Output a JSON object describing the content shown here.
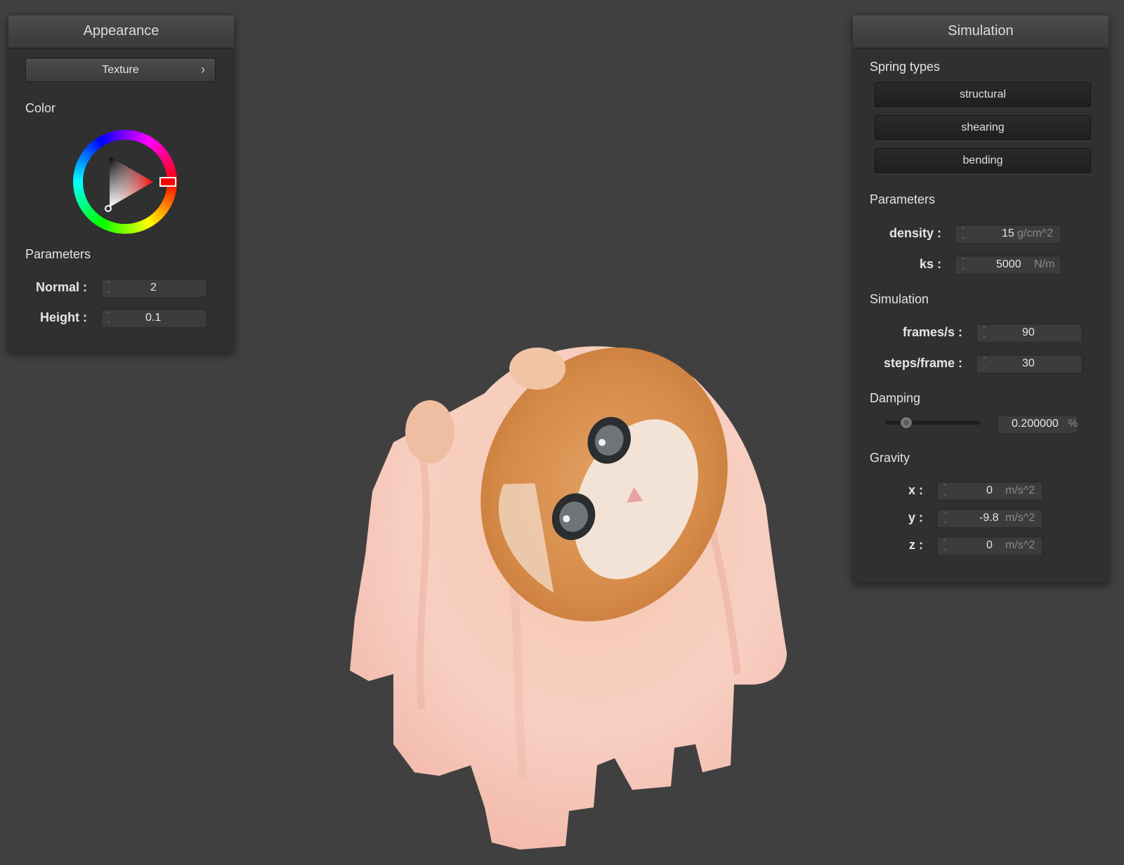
{
  "appearance": {
    "title": "Appearance",
    "texture_button": "Texture",
    "texture_chevron": "›",
    "color_label": "Color",
    "color_icon": "color-wheel-icon",
    "selected_color": "#ff0000",
    "parameters_label": "Parameters",
    "normal_label": "Normal :",
    "normal_value": "2",
    "height_label": "Height :",
    "height_value": "0.1"
  },
  "simulation": {
    "title": "Simulation",
    "spring_types_label": "Spring types",
    "spring_buttons": [
      "structural",
      "shearing",
      "bending"
    ],
    "parameters_label": "Parameters",
    "density_label": "density :",
    "density_value": "15",
    "density_unit": "g/cm^2",
    "ks_label": "ks :",
    "ks_value": "5000",
    "ks_unit": "N/m",
    "simulation_label": "Simulation",
    "fps_label": "frames/s :",
    "fps_value": "90",
    "steps_label": "steps/frame :",
    "steps_value": "30",
    "damping_label": "Damping",
    "damping_value": "0.200000",
    "damping_unit": "%",
    "damping_slider_fraction": 0.2,
    "gravity_label": "Gravity",
    "gx_label": "x :",
    "gx_value": "0",
    "gy_label": "y :",
    "gy_value": "-9.8",
    "gz_label": "z :",
    "gz_value": "0",
    "gravity_unit": "m/s^2"
  },
  "viewport": {
    "object": "cloth-draped-sphere-with-kitten-texture",
    "background": "#404040"
  }
}
